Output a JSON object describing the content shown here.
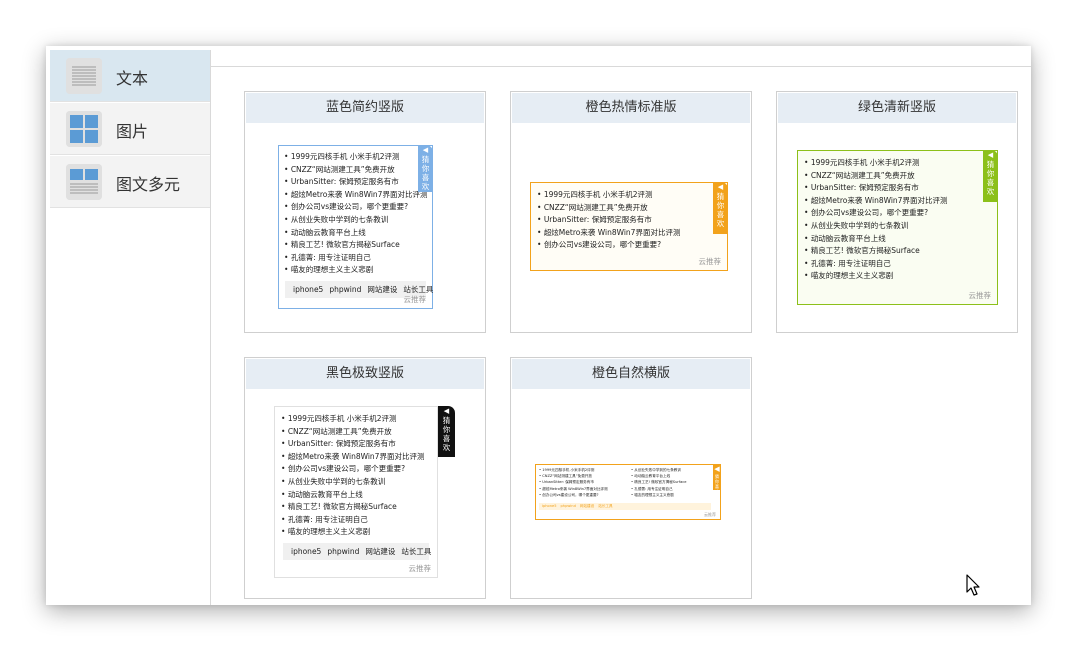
{
  "sidebar": {
    "items": [
      {
        "label": "文本",
        "icon": "text-lines-icon",
        "active": true
      },
      {
        "label": "图片",
        "icon": "image-grid-icon",
        "active": false
      },
      {
        "label": "图文多元",
        "icon": "image-text-icon",
        "active": false
      }
    ]
  },
  "colors": {
    "blue": "#7db0e6",
    "orange": "#f2a21b",
    "green": "#8cc01a",
    "black": "#111111",
    "header_bg": "#e6edf4",
    "active_bg": "#d9e7f0"
  },
  "flag_text": "猜你喜欢",
  "footer_text": "云推荐",
  "tags": [
    "iphone5",
    "phpwind",
    "网站建设",
    "站长工具"
  ],
  "list_items": [
    "1999元四核手机 小米手机2评测",
    "CNZZ“网站测建工具”免费开放",
    "UrbanSitter: 保姆预定服务有市",
    "超炫Metro来袭 Win8Win7界面对比评测",
    "创办公司vs建设公司，哪个更重要?",
    "从创业失败中学到的七条教训",
    "动动脑云教育平台上线",
    "精良工艺! 微软官方揭秘Surface",
    "孔德菁: 用专注证明自己",
    "喵友的理想主义主义悲剧"
  ],
  "templates": [
    {
      "title": "蓝色简约竖版"
    },
    {
      "title": "橙色热情标准版"
    },
    {
      "title": "绿色清新竖版"
    },
    {
      "title": "黑色极致竖版"
    },
    {
      "title": "橙色自然横版"
    }
  ]
}
